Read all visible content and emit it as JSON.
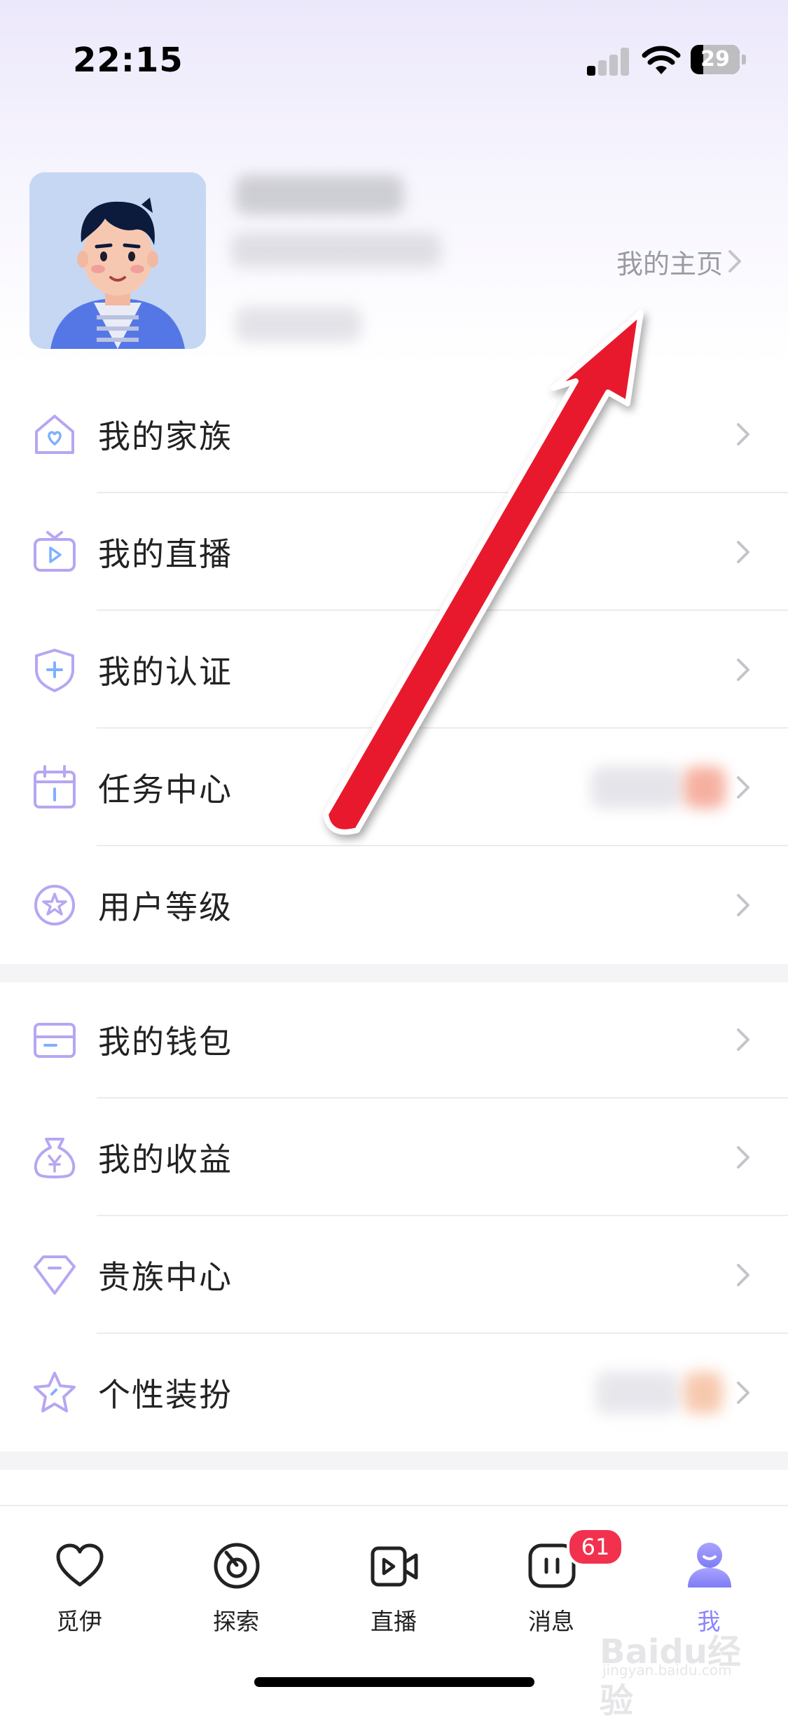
{
  "status_bar": {
    "time": "22:15",
    "battery": "29",
    "signal_icon": "cellular-signal-icon",
    "wifi_icon": "wifi-icon"
  },
  "profile": {
    "homepage_link": "我的主页",
    "avatar_icon": "cartoon-man-avatar"
  },
  "menu": {
    "group1": [
      {
        "label": "我的家族",
        "icon": "house-heart-icon"
      },
      {
        "label": "我的直播",
        "icon": "tv-play-icon"
      },
      {
        "label": "我的认证",
        "icon": "shield-plus-icon"
      },
      {
        "label": "任务中心",
        "icon": "calendar-icon"
      },
      {
        "label": "用户等级",
        "icon": "star-badge-icon"
      }
    ],
    "group2": [
      {
        "label": "我的钱包",
        "icon": "wallet-icon"
      },
      {
        "label": "我的收益",
        "icon": "money-bag-yen-icon"
      },
      {
        "label": "贵族中心",
        "icon": "diamond-icon"
      },
      {
        "label": "个性装扮",
        "icon": "sparkle-star-icon"
      }
    ]
  },
  "tab_bar": {
    "tabs": [
      {
        "label": "觅伊",
        "icon": "heart-outline-icon"
      },
      {
        "label": "探索",
        "icon": "compass-icon"
      },
      {
        "label": "直播",
        "icon": "video-camera-icon"
      },
      {
        "label": "消息",
        "icon": "message-icon",
        "badge": "61"
      },
      {
        "label": "我",
        "icon": "profile-person-icon",
        "active": true
      }
    ]
  },
  "watermark": {
    "logo": "Baidu经验",
    "sub": "jingyan.baidu.com"
  },
  "colors": {
    "accent_purple": "#8b84ff",
    "icon_purple": "#b7a6f2",
    "badge_red": "#f2314f",
    "annotation_arrow_red": "#e8192c"
  }
}
